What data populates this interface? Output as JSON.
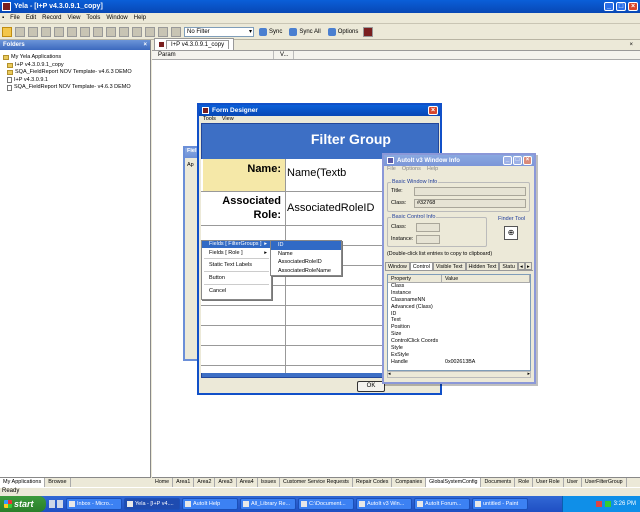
{
  "app": {
    "title": "Yela - [I+P v4.3.0.9.1_copy]"
  },
  "menubar": [
    "File",
    "Edit",
    "Record",
    "View",
    "Tools",
    "Window",
    "Help"
  ],
  "toolbar": {
    "filter_value": "No Filter",
    "sync": "Sync",
    "sync_all": "Sync All",
    "options": "Options"
  },
  "left_pane": {
    "header": "Folders",
    "close": "×",
    "tree": [
      {
        "label": "My Yela Applications",
        "kind": "folder"
      },
      {
        "label": "I+P v4.3.0.9.1_copy",
        "kind": "folder"
      },
      {
        "label": "SQA_FieldReport NOV Template- v4.6.3 DEMO",
        "kind": "folder"
      },
      {
        "label": "I+P v4.3.0.9.1",
        "kind": "doc"
      },
      {
        "label": "SQA_FieldReport NOV Template- v4.6.3 DEMO",
        "kind": "doc"
      }
    ],
    "tabs": [
      "My Applications",
      "Browse"
    ]
  },
  "doc_tab": "I+P v4.3.0.9.1_copy",
  "columns": [
    "Param",
    "V..."
  ],
  "bottom_tabs": [
    "Home",
    "Area1",
    "Area2",
    "Area3",
    "Area4",
    "Issues",
    "Customer Service Requests",
    "Repair Codes",
    "Companies",
    "GlobalSystemConfig",
    "Documents",
    "Role",
    "User Role",
    "User",
    "UserFilterGroup"
  ],
  "status": "Ready",
  "background_window": {
    "title": "Fiel",
    "label": "Ap"
  },
  "form_designer": {
    "title": "Form Designer",
    "menu": [
      "Tools",
      "View"
    ],
    "header": "Filter Group",
    "rows": [
      {
        "label": "Name:",
        "value": "Name(Textb"
      },
      {
        "label": "Associated Role:",
        "value": "AssociatedRoleID"
      }
    ],
    "ok": "OK"
  },
  "context_menu": {
    "items": [
      "Fields [ FilterGroups ]",
      "Fields [ Role ]",
      "Static Text Labels",
      "Button",
      "Cancel"
    ],
    "submenu": [
      "ID",
      "Name",
      "AssociatedRoleID",
      "AssociatedRoleName"
    ]
  },
  "autoit": {
    "title": "AutoIt v3 Window Info",
    "menu": [
      "File",
      "Options",
      "Help"
    ],
    "basic_window_info": "Basic Window Info",
    "title_label": "Title:",
    "class_label": "Class:",
    "class_value": "#32768",
    "basic_control_info": "Basic Control Info",
    "control_class_label": "Class:",
    "instance_label": "Instance:",
    "finder_tool": "Finder Tool",
    "hint": "(Double-click list entries to copy to clipboard)",
    "tabs": [
      "Window",
      "Control",
      "Visible Text",
      "Hidden Text",
      "Statu"
    ],
    "columns": [
      "Property",
      "Value"
    ],
    "properties": [
      [
        "Class",
        ""
      ],
      [
        "Instance",
        ""
      ],
      [
        "ClassnameNN",
        ""
      ],
      [
        "Advanced (Class)",
        ""
      ],
      [
        "ID",
        ""
      ],
      [
        "Text",
        ""
      ],
      [
        "Position",
        ""
      ],
      [
        "Size",
        ""
      ],
      [
        "ControlClick Coords",
        ""
      ],
      [
        "Style",
        ""
      ],
      [
        "ExStyle",
        ""
      ],
      [
        "Handle",
        "0x002613BA"
      ]
    ]
  },
  "taskbar": {
    "start": "start",
    "tasks": [
      "Inbox - Micro...",
      "Yela - [I+P v4....",
      "AutoIt Help",
      "All_Library Re...",
      "C:\\Document...",
      "AutoIt v3 Win...",
      "AutoIt Forum...",
      "untitled - Paint"
    ],
    "active": 1,
    "clock": "3:26 PM"
  }
}
